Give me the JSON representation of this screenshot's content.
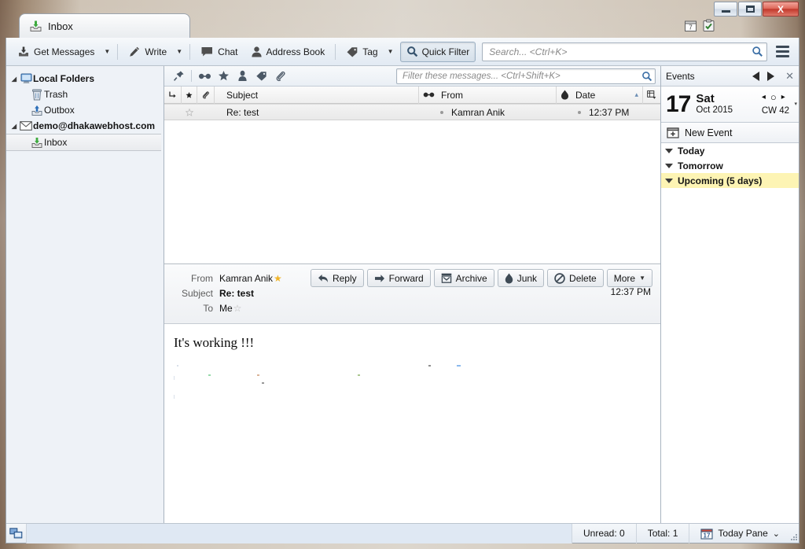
{
  "window": {
    "minimize_label": "Minimize",
    "maximize_label": "Maximize",
    "close_label": "X",
    "calendar_icon": "calendar-icon",
    "tasks_icon": "tasks-icon"
  },
  "tab": {
    "label": "Inbox",
    "icon": "inbox-icon"
  },
  "toolbar": {
    "get_messages": "Get Messages",
    "write": "Write",
    "chat": "Chat",
    "address_book": "Address Book",
    "tag": "Tag",
    "quick_filter": "Quick Filter",
    "search_placeholder": "Search... <Ctrl+K>",
    "dropdown_arrow": "▾",
    "menu_icon": "hamburger-menu-icon"
  },
  "folder_pane": {
    "items": [
      {
        "label": "Local Folders",
        "icon": "local-folders-icon",
        "level": 0,
        "bold": true,
        "twisty": "▴",
        "selected": false
      },
      {
        "label": "Trash",
        "icon": "trash-icon",
        "level": 1,
        "bold": false,
        "twisty": "",
        "selected": false
      },
      {
        "label": "Outbox",
        "icon": "outbox-icon",
        "level": 1,
        "bold": false,
        "twisty": "",
        "selected": false
      },
      {
        "label": "demo@dhakawebhost.com",
        "icon": "account-mail-icon",
        "level": 0,
        "bold": true,
        "twisty": "▴",
        "selected": false
      },
      {
        "label": "Inbox",
        "icon": "inbox-icon",
        "level": 1,
        "bold": false,
        "twisty": "",
        "selected": true
      }
    ]
  },
  "quick_filter_bar": {
    "icons": [
      "pin-icon",
      "unread-icon",
      "starred-icon",
      "contact-icon",
      "tag-icon",
      "attachment-icon"
    ],
    "filter_placeholder": "Filter these messages... <Ctrl+Shift+K>"
  },
  "message_list": {
    "columns": {
      "thread": "thread-column-icon",
      "star": "star-column-icon",
      "attachment": "attachment-column-icon",
      "subject": "Subject",
      "from_icon": "unread-column-icon",
      "from": "From",
      "date_icon": "junk-column-icon",
      "date": "Date",
      "sort_arrow": "▴",
      "column_picker": "column-picker-icon"
    },
    "rows": [
      {
        "subject": "Re: test",
        "from": "Kamran Anik",
        "date": "12:37 PM",
        "starred": false,
        "selected": true
      }
    ]
  },
  "message_header": {
    "from_label": "From",
    "from_value": "Kamran Anik",
    "from_star": "★",
    "subject_label": "Subject",
    "subject_value": "Re: test",
    "to_label": "To",
    "to_value": "Me",
    "to_star": "☆",
    "time": "12:37 PM",
    "actions": [
      {
        "label": "Reply",
        "icon": "reply-icon"
      },
      {
        "label": "Forward",
        "icon": "forward-icon"
      },
      {
        "label": "Archive",
        "icon": "archive-icon"
      },
      {
        "label": "Junk",
        "icon": "junk-icon"
      },
      {
        "label": "Delete",
        "icon": "delete-icon"
      },
      {
        "label": "More",
        "icon": "chevron-down-icon"
      }
    ]
  },
  "message_body": {
    "text": "It's working !!!"
  },
  "today_pane": {
    "title": "Events",
    "prev_label": "◀",
    "next_label": "▶",
    "close_label": "✕",
    "day_number": "17",
    "day_of_week": "Sat",
    "month_year": "Oct 2015",
    "week_number": "CW 42",
    "nav_prev": "◂",
    "nav_today": "○",
    "nav_next": "▸",
    "dropdown": "▾",
    "new_event": "New Event",
    "new_event_icon": "new-event-icon",
    "sections": [
      {
        "label": "Today",
        "highlighted": false
      },
      {
        "label": "Tomorrow",
        "highlighted": false
      },
      {
        "label": "Upcoming (5 days)",
        "highlighted": true
      }
    ]
  },
  "status_bar": {
    "left_icon": "network-status-icon",
    "unread": "Unread: 0",
    "total": "Total: 1",
    "today_pane": "Today Pane",
    "today_pane_icon": "calendar-17-icon",
    "today_pane_arrow": "⌄"
  },
  "colors": {
    "accent_blue": "#3a6ea5",
    "highlight_yellow": "#fdf4b4",
    "star_gold": "#f0b429",
    "green_arrow": "#3faa3f",
    "close_red": "#c2392c"
  }
}
